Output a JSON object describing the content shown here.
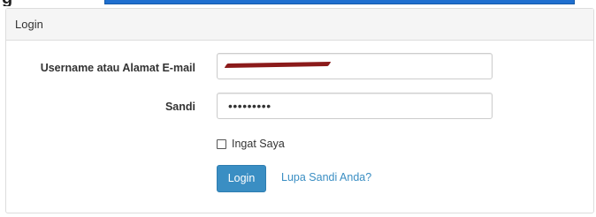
{
  "page": {
    "partial_heading_letter": "g"
  },
  "panel": {
    "title": "Login"
  },
  "form": {
    "username_label": "Username atau Alamat E-mail",
    "username_value_state": "redacted",
    "password_label": "Sandi",
    "password_masked_value": "•••••••••",
    "remember_label": "Ingat Saya",
    "remember_checked": false,
    "login_button_label": "Login",
    "forgot_link_label": "Lupa Sandi Anda?"
  },
  "colors": {
    "accent_bar": "#1f6fcf",
    "button": "#3a8ec3",
    "link": "#3a8ec3",
    "redaction": "#8b1a1a",
    "panel_heading_bg": "#f5f5f5",
    "border": "#dddddd"
  }
}
